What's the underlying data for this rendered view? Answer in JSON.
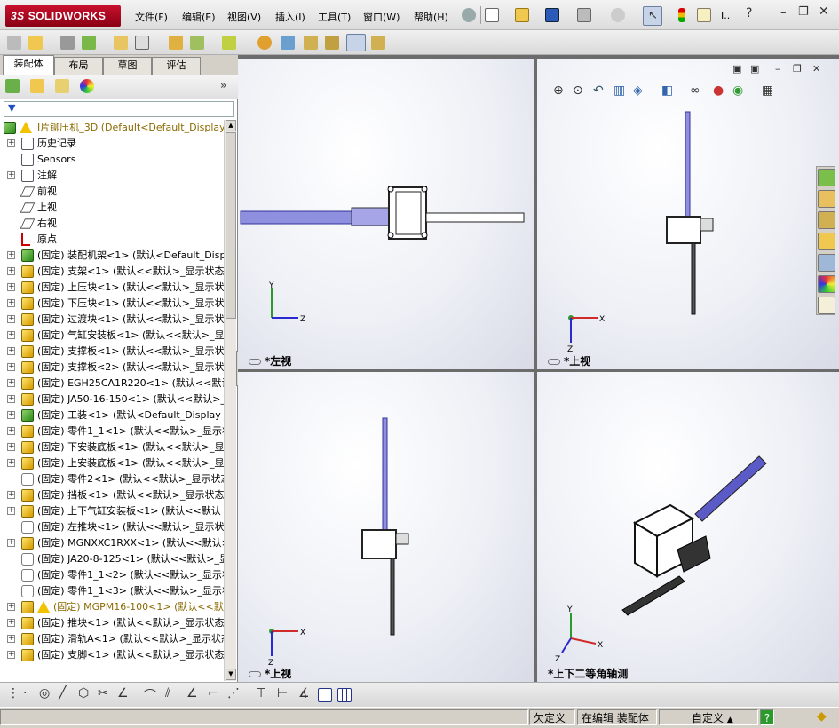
{
  "app": {
    "logo": "SOLIDWORKS",
    "logo_prefix": "3S"
  },
  "menu": [
    "文件(F)",
    "编辑(E)",
    "视图(V)",
    "插入(I)",
    "工具(T)",
    "窗口(W)",
    "帮助(H)"
  ],
  "menu_extra": "I..",
  "tabs": [
    "装配体",
    "布局",
    "草图",
    "评估"
  ],
  "tree": {
    "root": "I片铆压机_3D  (Default<Default_Display S",
    "items": [
      {
        "label": "历史记录",
        "icon": "history-icon",
        "exp": true
      },
      {
        "label": "Sensors",
        "icon": "sensor-icon",
        "exp": false
      },
      {
        "label": "注解",
        "icon": "annotation-icon",
        "exp": true
      },
      {
        "label": "前视",
        "icon": "plane-icon",
        "exp": false
      },
      {
        "label": "上视",
        "icon": "plane-icon",
        "exp": false
      },
      {
        "label": "右视",
        "icon": "plane-icon",
        "exp": false
      },
      {
        "label": "原点",
        "icon": "origin-icon",
        "exp": false
      },
      {
        "label": "(固定) 装配机架<1> (默认<Default_Displ",
        "icon": "assembly-icon",
        "exp": true
      },
      {
        "label": "(固定) 支架<1> (默认<<默认>_显示状态",
        "icon": "part-icon",
        "exp": true
      },
      {
        "label": "(固定) 上压块<1> (默认<<默认>_显示状",
        "icon": "part-icon",
        "exp": true
      },
      {
        "label": "(固定) 下压块<1> (默认<<默认>_显示状",
        "icon": "part-icon",
        "exp": true
      },
      {
        "label": "(固定) 过渡块<1> (默认<<默认>_显示状",
        "icon": "part-icon",
        "exp": true
      },
      {
        "label": "(固定) 气缸安装板<1> (默认<<默认>_显",
        "icon": "part-icon",
        "exp": true
      },
      {
        "label": "(固定) 支撑板<1> (默认<<默认>_显示状",
        "icon": "part-icon",
        "exp": true
      },
      {
        "label": "(固定) 支撑板<2> (默认<<默认>_显示状",
        "icon": "part-icon",
        "exp": true
      },
      {
        "label": "(固定) EGH25CA1R220<1> (默认<<默认",
        "icon": "part-icon",
        "exp": true
      },
      {
        "label": "(固定) JA50-16-150<1> (默认<<默认>_显",
        "icon": "part-icon",
        "exp": true
      },
      {
        "label": "(固定) 工装<1> (默认<Default_Display St",
        "icon": "assembly-icon",
        "exp": true
      },
      {
        "label": "(固定) 零件1_1<1> (默认<<默认>_显示状",
        "icon": "part-icon",
        "exp": true
      },
      {
        "label": "(固定) 下安装底板<1> (默认<<默认>_显",
        "icon": "part-icon",
        "exp": true
      },
      {
        "label": "(固定) 上安装底板<1> (默认<<默认>_显",
        "icon": "part-icon",
        "exp": true
      },
      {
        "label": "(固定) 零件2<1> (默认<<默认>_显示状态",
        "icon": "sub-icon",
        "exp": false
      },
      {
        "label": "(固定) 挡板<1> (默认<<默认>_显示状态",
        "icon": "part-icon",
        "exp": true
      },
      {
        "label": "(固定) 上下气缸安装板<1> (默认<<默认",
        "icon": "part-icon",
        "exp": true
      },
      {
        "label": "(固定) 左推块<1> (默认<<默认>_显示状",
        "icon": "sub-icon",
        "exp": false
      },
      {
        "label": "(固定) MGNXXC1RXX<1> (默认<<默认>_",
        "icon": "part-icon",
        "exp": true
      },
      {
        "label": "(固定) JA20-8-125<1> (默认<<默认>_显示",
        "icon": "sub-icon",
        "exp": false
      },
      {
        "label": "(固定) 零件1_1<2> (默认<<默认>_显示状",
        "icon": "sub-icon",
        "exp": false
      },
      {
        "label": "(固定) 零件1_1<3> (默认<<默认>_显示状",
        "icon": "sub-icon",
        "exp": false
      },
      {
        "label": "(固定) MGPM16-100<1> (默认<<默认>",
        "icon": "warn-icon",
        "exp": true
      },
      {
        "label": "(固定) 推块<1> (默认<<默认>_显示状态",
        "icon": "part-icon",
        "exp": true
      },
      {
        "label": "(固定) 滑轨A<1> (默认<<默认>_显示状态",
        "icon": "part-icon",
        "exp": true
      },
      {
        "label": "(固定) 支脚<1> (默认<<默认>_显示状态",
        "icon": "part-icon",
        "exp": true
      }
    ]
  },
  "viewports": {
    "left_view": "*左视",
    "top_view": "*上视",
    "top_view2": "*上视",
    "iso_view": "*上下二等角轴测"
  },
  "axes": {
    "x": "X",
    "y": "Y",
    "z": "Z"
  },
  "status": {
    "state": "欠定义",
    "editing": "在编辑 装配体",
    "custom": "自定义",
    "help": "?"
  },
  "colors": {
    "accent": "#c8102e",
    "model_blue": "#7a7ad6",
    "status_bg": "#d4d0c8"
  }
}
